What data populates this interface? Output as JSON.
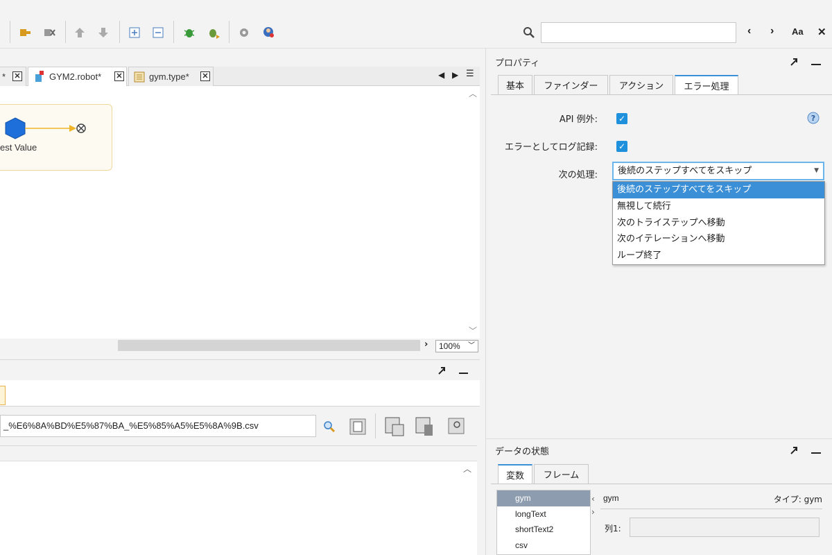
{
  "toolbar": {
    "buttons": [
      "insert-step-icon",
      "remove-step-icon",
      "move-up-icon",
      "move-down-icon",
      "expand-icon",
      "collapse-icon",
      "debug-icon",
      "debug-step-icon",
      "settings-icon",
      "user-icon"
    ],
    "search": {
      "value": "",
      "placeholder": ""
    },
    "match_case_label": "Aa",
    "close_glyph": "✕",
    "prev_glyph": "‹",
    "next_glyph": "›"
  },
  "editor": {
    "tabs": [
      {
        "label": "*",
        "active": false
      },
      {
        "label": "GYM2.robot*",
        "active": true
      },
      {
        "label": "gym.type*",
        "active": false
      }
    ],
    "node_label": "est Value",
    "zoom": "100%"
  },
  "bottom_left": {
    "file_path": "_%E6%8A%BD%E5%87%BA_%E5%85%A5%E5%8A%9B.csv"
  },
  "properties": {
    "title": "プロパティ",
    "tabs": [
      "基本",
      "ファインダー",
      "アクション",
      "エラー処理"
    ],
    "active_tab": "エラー処理",
    "api_exception_label": "API 例外:",
    "api_exception_checked": true,
    "log_as_error_label": "エラーとしてログ記録:",
    "log_as_error_checked": true,
    "next_action_label": "次の処理:",
    "next_action_value": "後続のステップすべてをスキップ",
    "next_action_options": [
      "後続のステップすべてをスキップ",
      "無視して続行",
      "次のトライステップへ移動",
      "次のイテレーションへ移動",
      "ループ終了"
    ]
  },
  "data_state": {
    "title": "データの状態",
    "tabs": [
      "変数",
      "フレーム"
    ],
    "variables": [
      "gym",
      "longText",
      "shortText2",
      "csv"
    ],
    "selected_variable": "gym",
    "detail_name": "gym",
    "detail_type": "タイプ: gym",
    "column_label": "列1:"
  },
  "colors": {
    "accent": "#3a8fd6",
    "checkbox": "#1e90dc",
    "node": "#1e6fd9",
    "node_arrow": "#f0b429"
  }
}
